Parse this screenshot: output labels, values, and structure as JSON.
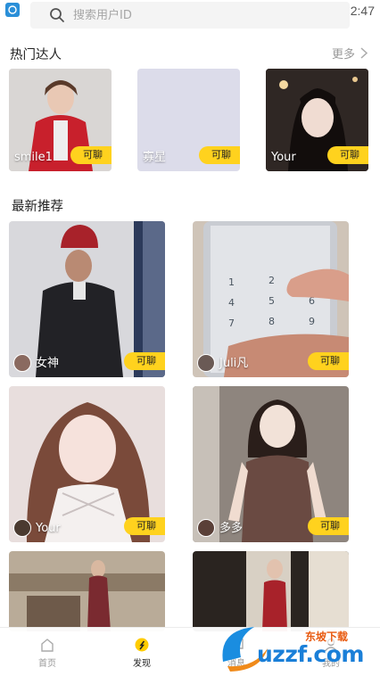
{
  "status_bar": {
    "time": "2:47"
  },
  "search": {
    "placeholder": "搜索用户ID"
  },
  "hot": {
    "title": "热门达人",
    "more_label": "更多",
    "cards": [
      {
        "name": "smile1",
        "badge": "可聊"
      },
      {
        "name": "寡星",
        "badge": "可聊"
      },
      {
        "name": "Your",
        "badge": "可聊"
      }
    ]
  },
  "recommend": {
    "title": "最新推荐",
    "cards": [
      {
        "name": "女神",
        "badge": "可聊"
      },
      {
        "name": "Juli凡",
        "badge": "可聊"
      },
      {
        "name": "Your",
        "badge": "可聊"
      },
      {
        "name": "多多",
        "badge": "可聊"
      }
    ]
  },
  "nav": {
    "items": [
      {
        "label": "首页",
        "icon": "home-icon",
        "active": false
      },
      {
        "label": "发现",
        "icon": "discover-icon",
        "active": true
      },
      {
        "label": "消息",
        "icon": "message-icon",
        "active": false
      },
      {
        "label": "我的",
        "icon": "profile-icon",
        "active": false
      }
    ]
  },
  "watermark": {
    "brand": "uzzf.com",
    "tagline": "东坡下载"
  },
  "colors": {
    "badge": "#ffd21e",
    "accent": "#ffcc00",
    "text_muted": "#999999"
  }
}
